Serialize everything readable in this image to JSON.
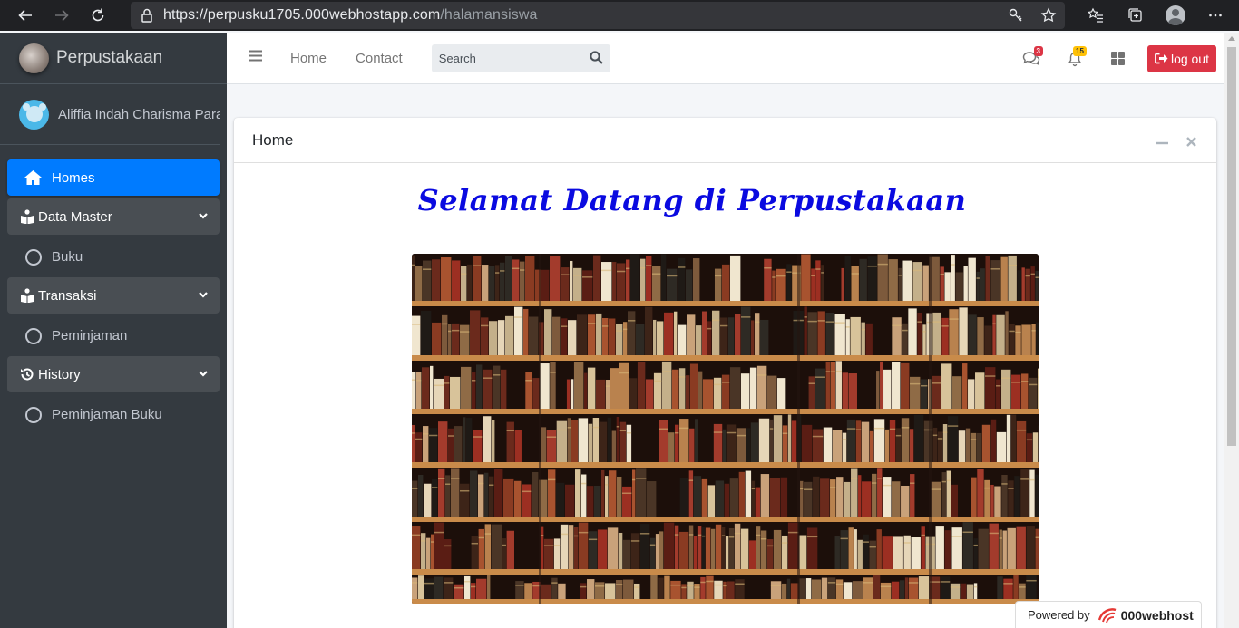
{
  "browser": {
    "url_host": "https://perpusku1705.000webhostapp.com",
    "url_path": "/halamansiswa"
  },
  "sidebar": {
    "brand": "Perpustakaan",
    "user_name": "Aliffia Indah Charisma Para",
    "menu": {
      "homes": "Homes",
      "data_master": "Data Master",
      "buku": "Buku",
      "transaksi": "Transaksi",
      "peminjaman": "Peminjaman",
      "history": "History",
      "peminjaman_buku": "Peminjaman Buku"
    }
  },
  "topbar": {
    "home": "Home",
    "contact": "Contact",
    "search_placeholder": "Search",
    "messages_count": "3",
    "notifications_count": "15",
    "logout": "log out"
  },
  "card": {
    "title": "Home",
    "welcome": "Selamat Datang di Perpustakaan"
  },
  "footer": {
    "powered_by": "Powered by",
    "host_brand": "000webhost"
  },
  "colors": {
    "sidebar_bg": "#343a40",
    "active_item": "#007bff",
    "logout_button": "#dc3545",
    "welcome_text": "#0a0ae0"
  }
}
